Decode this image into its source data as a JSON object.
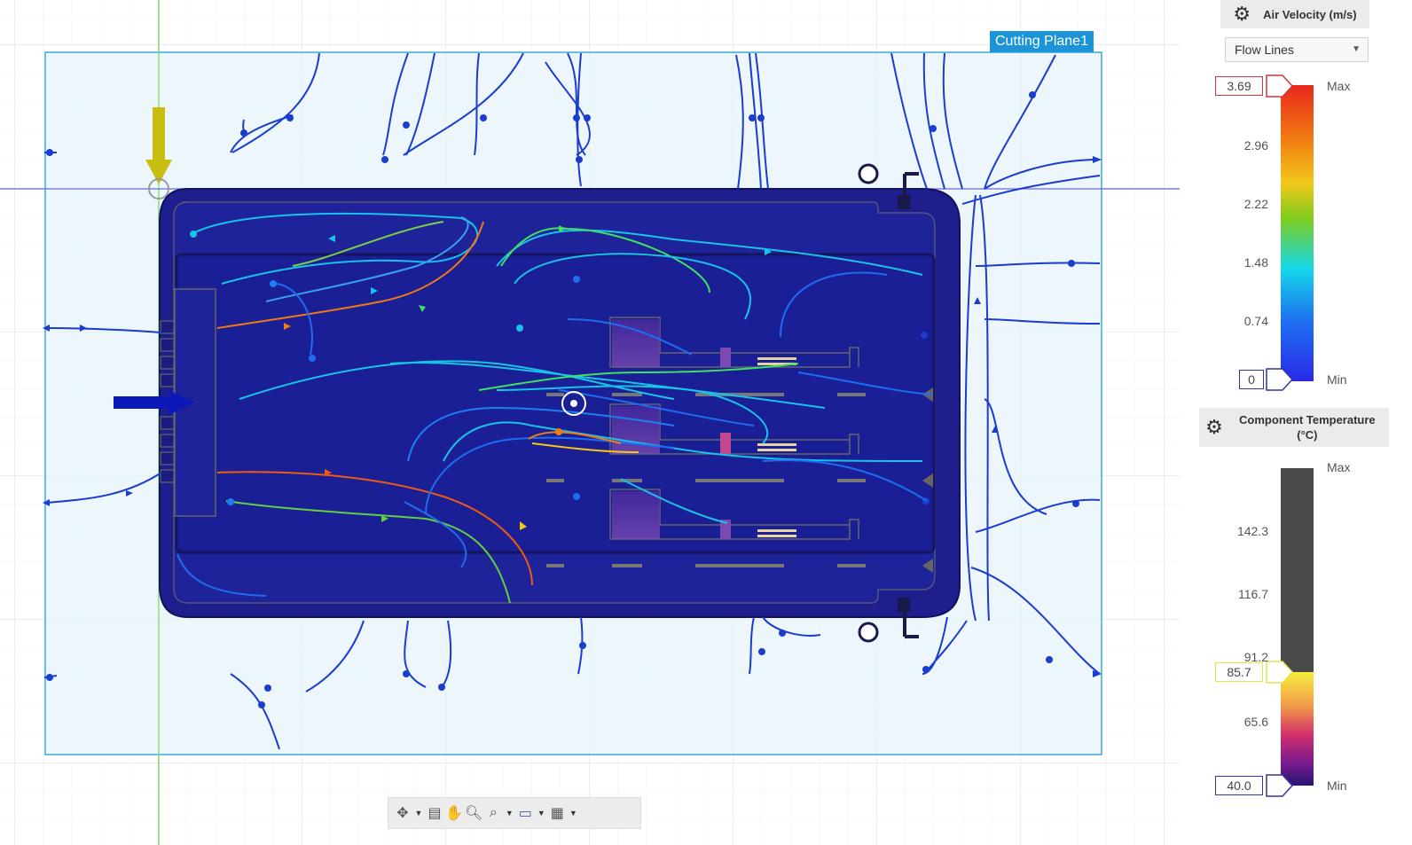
{
  "viewport": {
    "cutting_plane_label": "Cutting Plane1"
  },
  "velocity_legend": {
    "title": "Air Velocity (m/s)",
    "icon": "gear-icon",
    "display_mode": "Flow Lines",
    "max_value": "3.69",
    "min_value": "0",
    "max_label": "Max",
    "min_label": "Min",
    "ticks": [
      "2.96",
      "2.22",
      "1.48",
      "0.74"
    ],
    "gradient_colors": [
      "#e8271c",
      "#f07b12",
      "#f3c81a",
      "#7fcc1e",
      "#14d8e9",
      "#1e6df0",
      "#2a2ae8"
    ]
  },
  "temperature_legend": {
    "title": "Component Temperature (°C)",
    "icon": "gear-icon",
    "max_label": "Max",
    "min_label": "Min",
    "ticks": [
      "142.3",
      "116.7",
      "91.2",
      "65.6"
    ],
    "current_value": "85.7",
    "min_value": "40.0",
    "gradient_colors": [
      "#f7ec3c",
      "#f19a4a",
      "#d2306a",
      "#7a1a8f",
      "#261673"
    ],
    "inactive_color": "#4a4a4a"
  },
  "bottom_toolbar": {
    "items": [
      "orbit-icon",
      "look-at-icon",
      "pan-icon",
      "zoom-icon",
      "fit-icon",
      "display-settings-icon",
      "grid-settings-icon"
    ]
  }
}
